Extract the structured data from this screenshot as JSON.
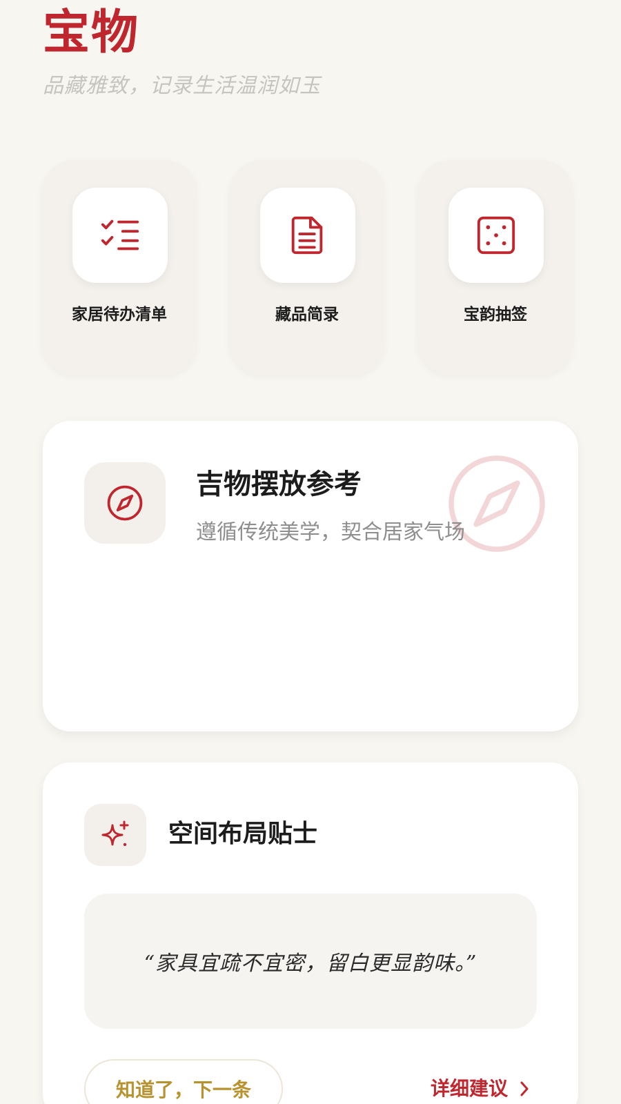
{
  "app": {
    "title": "宝物",
    "subtitle": "品藏雅致，记录生活温润如玉"
  },
  "tools": [
    {
      "label": "家居待办清单",
      "icon": "checklist-icon"
    },
    {
      "label": "藏品简录",
      "icon": "document-icon"
    },
    {
      "label": "宝韵抽签",
      "icon": "dice-icon"
    }
  ],
  "feature": {
    "title": "吉物摆放参考",
    "description": "遵循传统美学，契合居家气场",
    "icon": "compass-icon"
  },
  "tips": {
    "title": "空间布局贴士",
    "icon": "sparkles-icon",
    "quote": "“家具宜疏不宜密，留白更显韵味。”",
    "next_label": "知道了，下一条",
    "detail_label": "详细建议"
  },
  "colors": {
    "accent": "#c0262d",
    "gold": "#b8922f",
    "background": "#f8f6f1"
  }
}
